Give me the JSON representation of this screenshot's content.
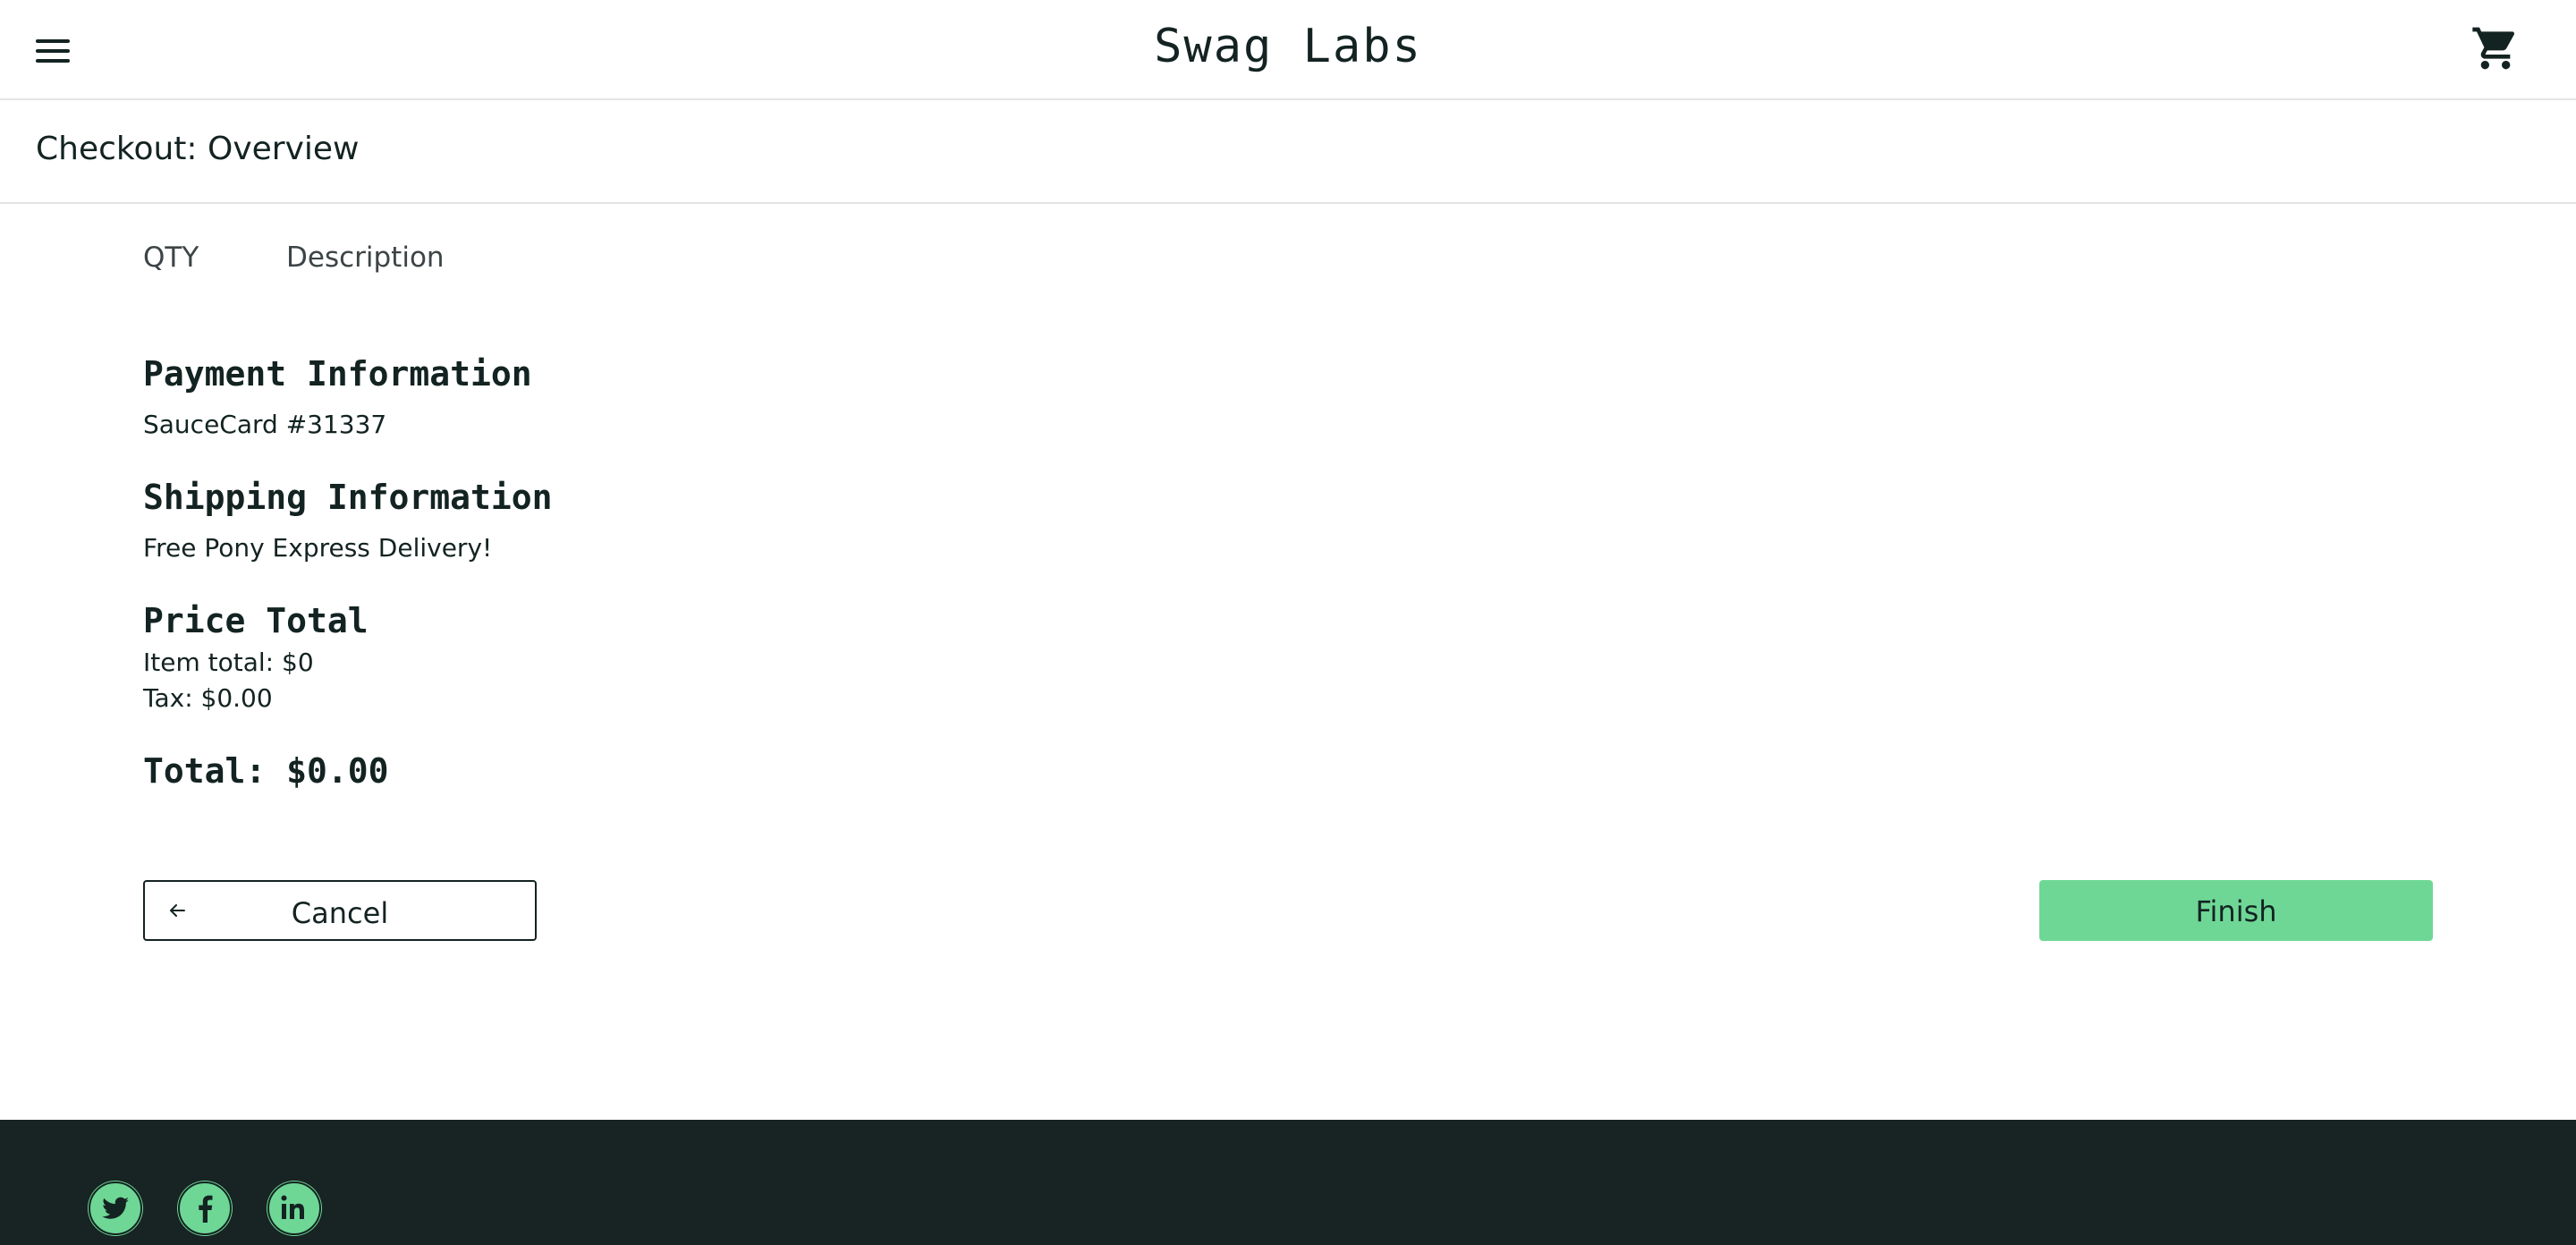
{
  "header": {
    "app_title": "Swag Labs",
    "menu_icon": "hamburger-menu-icon",
    "cart_icon": "shopping-cart-icon"
  },
  "secondary_header": {
    "title": "Checkout: Overview"
  },
  "cart_list": {
    "qty_label": "QTY",
    "description_label": "Description",
    "items": []
  },
  "summary": {
    "payment_label": "Payment Information",
    "payment_value": "SauceCard #31337",
    "shipping_label": "Shipping Information",
    "shipping_value": "Free Pony Express Delivery!",
    "price_total_label": "Price Total",
    "item_total": "Item total: $0",
    "tax": "Tax: $0.00",
    "total": "Total: $0.00"
  },
  "actions": {
    "cancel_label": "Cancel",
    "cancel_icon": "arrow-left-icon",
    "finish_label": "Finish"
  },
  "footer": {
    "social_links": [
      "twitter-icon",
      "facebook-icon",
      "linkedin-icon"
    ]
  },
  "colors": {
    "accent": "#6ed796",
    "text": "#132322",
    "footer_bg": "#182323",
    "divider": "#e4e4e4"
  }
}
